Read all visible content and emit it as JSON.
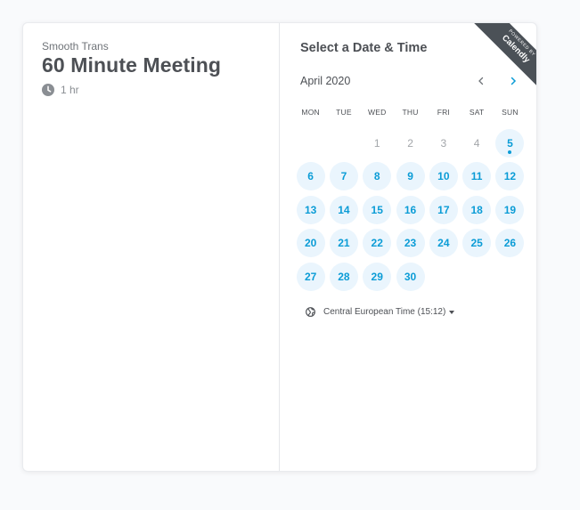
{
  "event": {
    "organizer": "Smooth Trans",
    "title": "60 Minute Meeting",
    "duration": "1 hr"
  },
  "scheduler": {
    "heading": "Select a Date & Time",
    "month_label": "April 2020",
    "weekdays": [
      "MON",
      "TUE",
      "WED",
      "THU",
      "FRI",
      "SAT",
      "SUN"
    ],
    "days": [
      {
        "n": "",
        "s": "empty"
      },
      {
        "n": "",
        "s": "empty"
      },
      {
        "n": "1",
        "s": "unavailable"
      },
      {
        "n": "2",
        "s": "unavailable"
      },
      {
        "n": "3",
        "s": "unavailable"
      },
      {
        "n": "4",
        "s": "unavailable"
      },
      {
        "n": "5",
        "s": "today"
      },
      {
        "n": "6",
        "s": "available"
      },
      {
        "n": "7",
        "s": "available"
      },
      {
        "n": "8",
        "s": "available"
      },
      {
        "n": "9",
        "s": "available"
      },
      {
        "n": "10",
        "s": "available"
      },
      {
        "n": "11",
        "s": "available"
      },
      {
        "n": "12",
        "s": "available"
      },
      {
        "n": "13",
        "s": "available"
      },
      {
        "n": "14",
        "s": "available"
      },
      {
        "n": "15",
        "s": "available"
      },
      {
        "n": "16",
        "s": "available"
      },
      {
        "n": "17",
        "s": "available"
      },
      {
        "n": "18",
        "s": "available"
      },
      {
        "n": "19",
        "s": "available"
      },
      {
        "n": "20",
        "s": "available"
      },
      {
        "n": "21",
        "s": "available"
      },
      {
        "n": "22",
        "s": "available"
      },
      {
        "n": "23",
        "s": "available"
      },
      {
        "n": "24",
        "s": "available"
      },
      {
        "n": "25",
        "s": "available"
      },
      {
        "n": "26",
        "s": "available"
      },
      {
        "n": "27",
        "s": "available"
      },
      {
        "n": "28",
        "s": "available"
      },
      {
        "n": "29",
        "s": "available"
      },
      {
        "n": "30",
        "s": "available"
      }
    ],
    "timezone": "Central European Time (15:12)"
  },
  "ribbon": {
    "powered_by": "POWERED BY",
    "brand": "Calendly"
  },
  "icons": {
    "duration": "clock-icon",
    "prev_month": "chevron-left-icon",
    "next_month": "chevron-right-icon",
    "timezone": "globe-icon",
    "timezone_dropdown": "caret-down-icon"
  },
  "colors": {
    "accent": "#0b9cd6",
    "available_bg": "#eaf5fd",
    "ribbon": "#4b5157",
    "page_bg": "#f9fafc"
  }
}
